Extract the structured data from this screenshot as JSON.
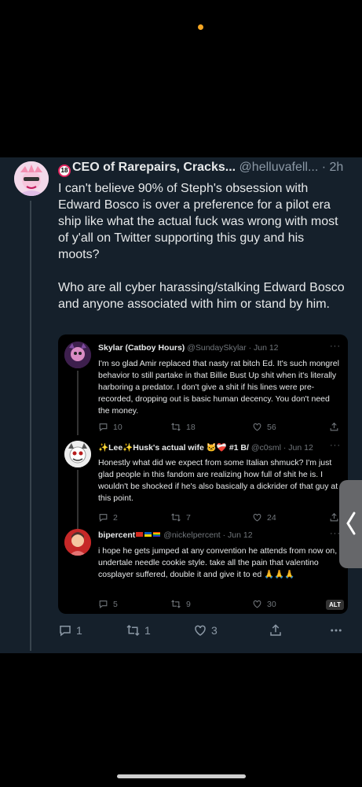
{
  "post": {
    "display_name": "CEO of Rarepairs, Cracks...",
    "handle": "@helluvafell...",
    "time": "· 2h",
    "text": "I can't believe 90% of Steph's obsession with Edward Bosco is over a preference for a pilot era ship like what the actual fuck was wrong with most of y'all on Twitter supporting this guy and his moots?\n\nWho are all cyber harassing/stalking Edward Bosco and anyone associated with him or stand by him.",
    "badge_icon": "18-plus-badge-icon",
    "actions": {
      "replies": "1",
      "retweets": "1",
      "likes": "3"
    }
  },
  "embed": {
    "alt_label": "ALT",
    "replies": [
      {
        "name": "Skylar (Catboy Hours)",
        "handle": "@SundaySkylar · Jun 12",
        "text": "I'm so glad Amir replaced that nasty rat bitch Ed. It's such mongrel behavior to still partake in that Billie Bust Up shit when it's literally harboring a predator. I don't give a shit if his lines were pre-recorded, dropping out is basic human decency. You don't need the money.",
        "replies": "10",
        "retweets": "18",
        "likes": "56",
        "more": "···"
      },
      {
        "name": "✨Lee✨Husk's actual wife 🐱❤️‍🩹 #1 B/",
        "handle": "@c0sml · Jun 12",
        "text": "Honestly what did we expect from some Italian shmuck? I'm just glad people in this fandom are realizing how full of shit he is. I wouldn't be shocked if he's also basically a dickrider of that guy at this point.",
        "replies": "2",
        "retweets": "7",
        "likes": "24",
        "more": "···"
      },
      {
        "name": "bipercent",
        "handle": "@nickelpercent · Jun 12",
        "text": "i hope he gets jumped at any convention he attends from now on, undertale needle cookie style. take all the pain that valentino cosplayer suffered, double it and give it to ed 🙏🙏🙏",
        "replies": "5",
        "retweets": "9",
        "likes": "30",
        "more": "···"
      }
    ]
  },
  "colors": {
    "post_bg": "#15202b",
    "text": "#e7e9ea",
    "muted": "#8b98a5",
    "status_dot": "#f5a623"
  }
}
